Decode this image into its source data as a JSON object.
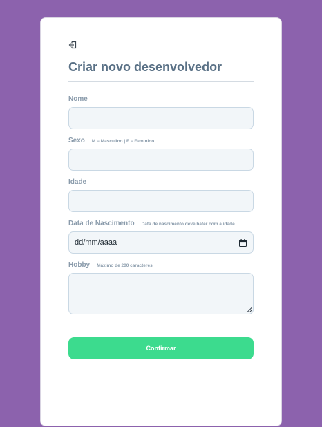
{
  "page": {
    "title": "Criar novo desenvolvedor",
    "back_icon": "sign-out-icon"
  },
  "form": {
    "nome": {
      "label": "Nome",
      "value": "",
      "placeholder": ""
    },
    "sexo": {
      "label": "Sexo",
      "hint": "M = Masculino | F = Feminino",
      "value": "",
      "placeholder": ""
    },
    "idade": {
      "label": "Idade",
      "value": "",
      "placeholder": ""
    },
    "nascimento": {
      "label": "Data de Nascimento",
      "hint": "Data de nascimento deve bater com a idade",
      "value": "dd/mm/aaaa",
      "icon": "calendar-icon"
    },
    "hobby": {
      "label": "Hobby",
      "hint": "Máximo de 200 caracteres",
      "value": "",
      "placeholder": ""
    }
  },
  "actions": {
    "confirm_label": "Confirmar"
  },
  "colors": {
    "background": "#8c62ad",
    "card": "#ffffff",
    "title": "#5a7186",
    "label": "#8a9bab",
    "field_bg": "#f2f6f9",
    "field_border": "#c9d8e4",
    "confirm": "#3cdb8e"
  }
}
